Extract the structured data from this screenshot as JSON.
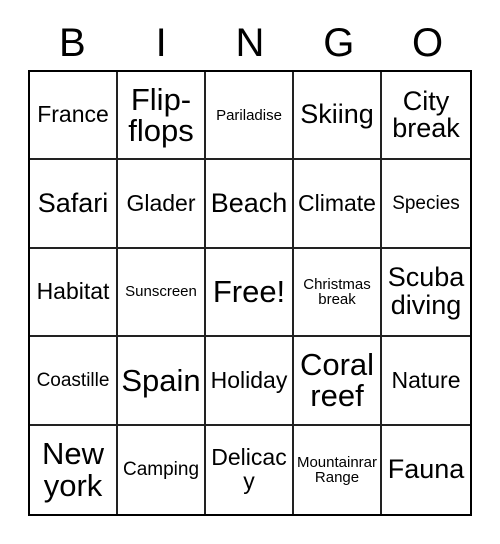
{
  "card": {
    "type": "bingo-card",
    "header": {
      "letters": [
        "B",
        "I",
        "N",
        "G",
        "O"
      ]
    },
    "grid": {
      "columns": 5,
      "rows": 5,
      "free_space": {
        "row": 2,
        "column": 2,
        "label": "Free!"
      },
      "cells": [
        [
          {
            "text": "France",
            "size": "md"
          },
          {
            "text": "Flip-flops",
            "size": "xl"
          },
          {
            "text": "Pariladise",
            "size": "xs"
          },
          {
            "text": "Skiing",
            "size": "lg"
          },
          {
            "text": "City break",
            "size": "lg"
          }
        ],
        [
          {
            "text": "Safari",
            "size": "lg"
          },
          {
            "text": "Glader",
            "size": "md"
          },
          {
            "text": "Beach",
            "size": "lg"
          },
          {
            "text": "Climate",
            "size": "md"
          },
          {
            "text": "Species",
            "size": "sm"
          }
        ],
        [
          {
            "text": "Habitat",
            "size": "md"
          },
          {
            "text": "Sunscreen",
            "size": "xs"
          },
          {
            "text": "Free!",
            "size": "free"
          },
          {
            "text": "Christmas break",
            "size": "xs"
          },
          {
            "text": "Scuba diving",
            "size": "lg"
          }
        ],
        [
          {
            "text": "Coastille",
            "size": "sm"
          },
          {
            "text": "Spain",
            "size": "xl"
          },
          {
            "text": "Holiday",
            "size": "md"
          },
          {
            "text": "Coral reef",
            "size": "xl"
          },
          {
            "text": "Nature",
            "size": "md"
          }
        ],
        [
          {
            "text": "New york",
            "size": "xl"
          },
          {
            "text": "Camping",
            "size": "sm"
          },
          {
            "text": "Delicacy",
            "size": "md"
          },
          {
            "text": "Mountainrar Range",
            "size": "xs"
          },
          {
            "text": "Fauna",
            "size": "lg"
          }
        ]
      ]
    },
    "colors": {
      "background": "#ffffff",
      "text": "#000000",
      "grid_line": "#222222",
      "border": "#000000"
    }
  }
}
